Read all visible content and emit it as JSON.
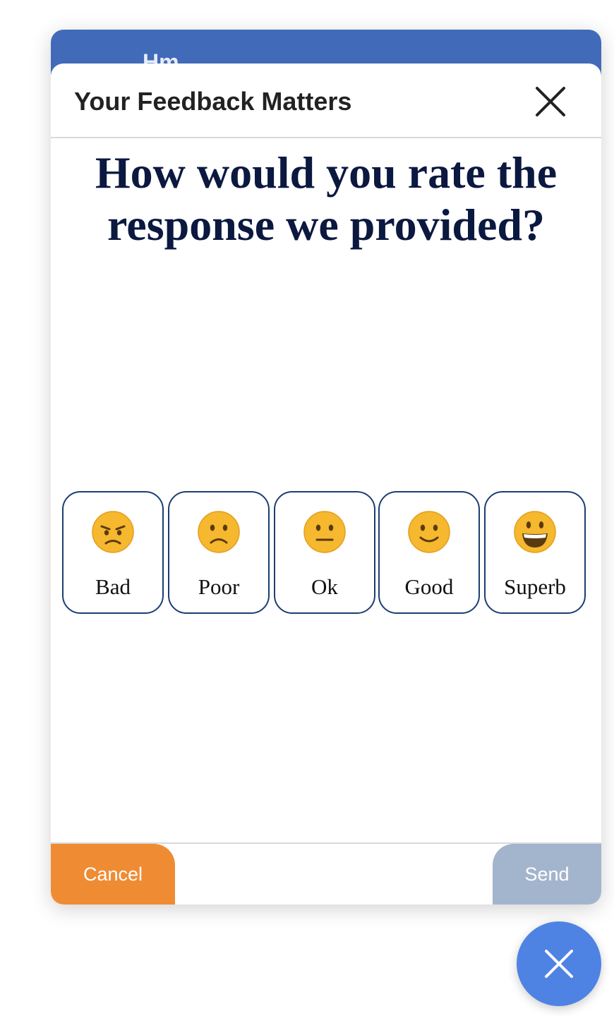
{
  "widget": {
    "header_title": "Hm"
  },
  "modal": {
    "title": "Your Feedback Matters",
    "close_icon": "close-icon",
    "question": "How would you rate the response we provided?"
  },
  "ratings": [
    {
      "label": "Bad",
      "icon": "angry-face-icon"
    },
    {
      "label": "Poor",
      "icon": "slightly-frowning-face-icon"
    },
    {
      "label": "Ok",
      "icon": "neutral-face-icon"
    },
    {
      "label": "Good",
      "icon": "slightly-smiling-face-icon"
    },
    {
      "label": "Superb",
      "icon": "grinning-face-icon"
    }
  ],
  "footer": {
    "cancel_label": "Cancel",
    "send_label": "Send"
  },
  "fab": {
    "icon": "close-icon"
  },
  "colors": {
    "header_blue": "#416bb9",
    "question_navy": "#0b1840",
    "card_border": "#1b3e72",
    "cancel_orange": "#ef8c33",
    "send_disabled": "#a3b4cd",
    "fab_blue": "#4f83e3",
    "emoji_yellow": "#f5b82e"
  }
}
